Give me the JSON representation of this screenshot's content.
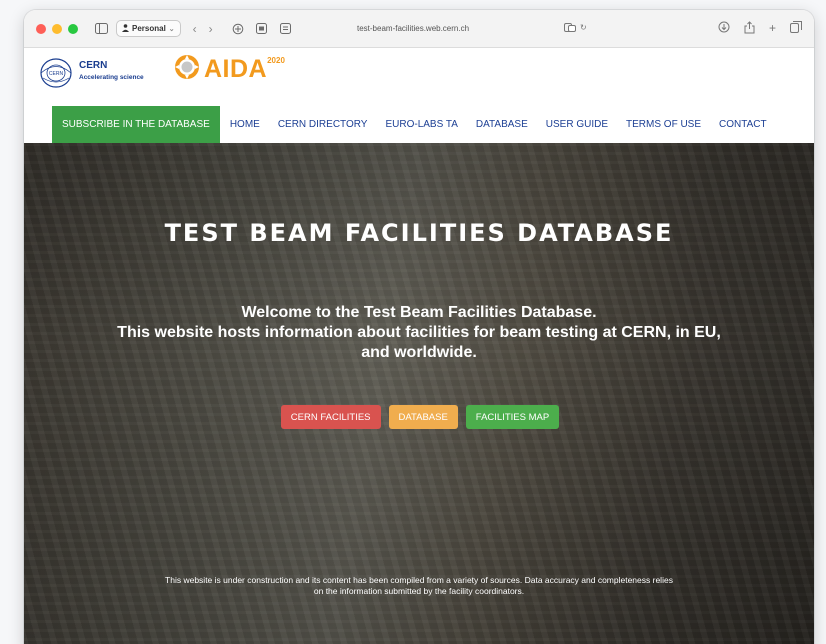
{
  "browser": {
    "profile_label": "Personal",
    "address": "test-beam-facilities.web.cern.ch"
  },
  "header": {
    "cern_title": "CERN",
    "cern_subtitle": "Accelerating science",
    "aida_name": "AIDA",
    "aida_year": "2020"
  },
  "nav": {
    "subscribe": "SUBSCRIBE IN THE DATABASE",
    "items": [
      "HOME",
      "CERN DIRECTORY",
      "EURO-LABS TA",
      "DATABASE",
      "USER GUIDE",
      "TERMS OF USE",
      "CONTACT"
    ]
  },
  "hero": {
    "title": "TEST BEAM FACILITIES DATABASE",
    "welcome_line1": "Welcome to the Test Beam Facilities Database.",
    "welcome_line2": "This website hosts information about facilities for beam testing at CERN, in EU,",
    "welcome_line3": "and worldwide.",
    "buttons": {
      "cern_facilities": "CERN FACILITIES",
      "database": "DATABASE",
      "facilities_map": "FACILITIES MAP"
    },
    "disclaimer_line1": "This website is under construction and its content has been compiled from a variety of sources. Data accuracy and completeness relies",
    "disclaimer_line2": "on the information submitted by the facility coordinators."
  },
  "colors": {
    "subscribe_green": "#3c9f47",
    "nav_blue": "#1c3f94",
    "btn_red": "#d9534f",
    "btn_orange": "#f0ad4e",
    "btn_green": "#4cae4c",
    "aida_orange": "#f29a1e"
  }
}
